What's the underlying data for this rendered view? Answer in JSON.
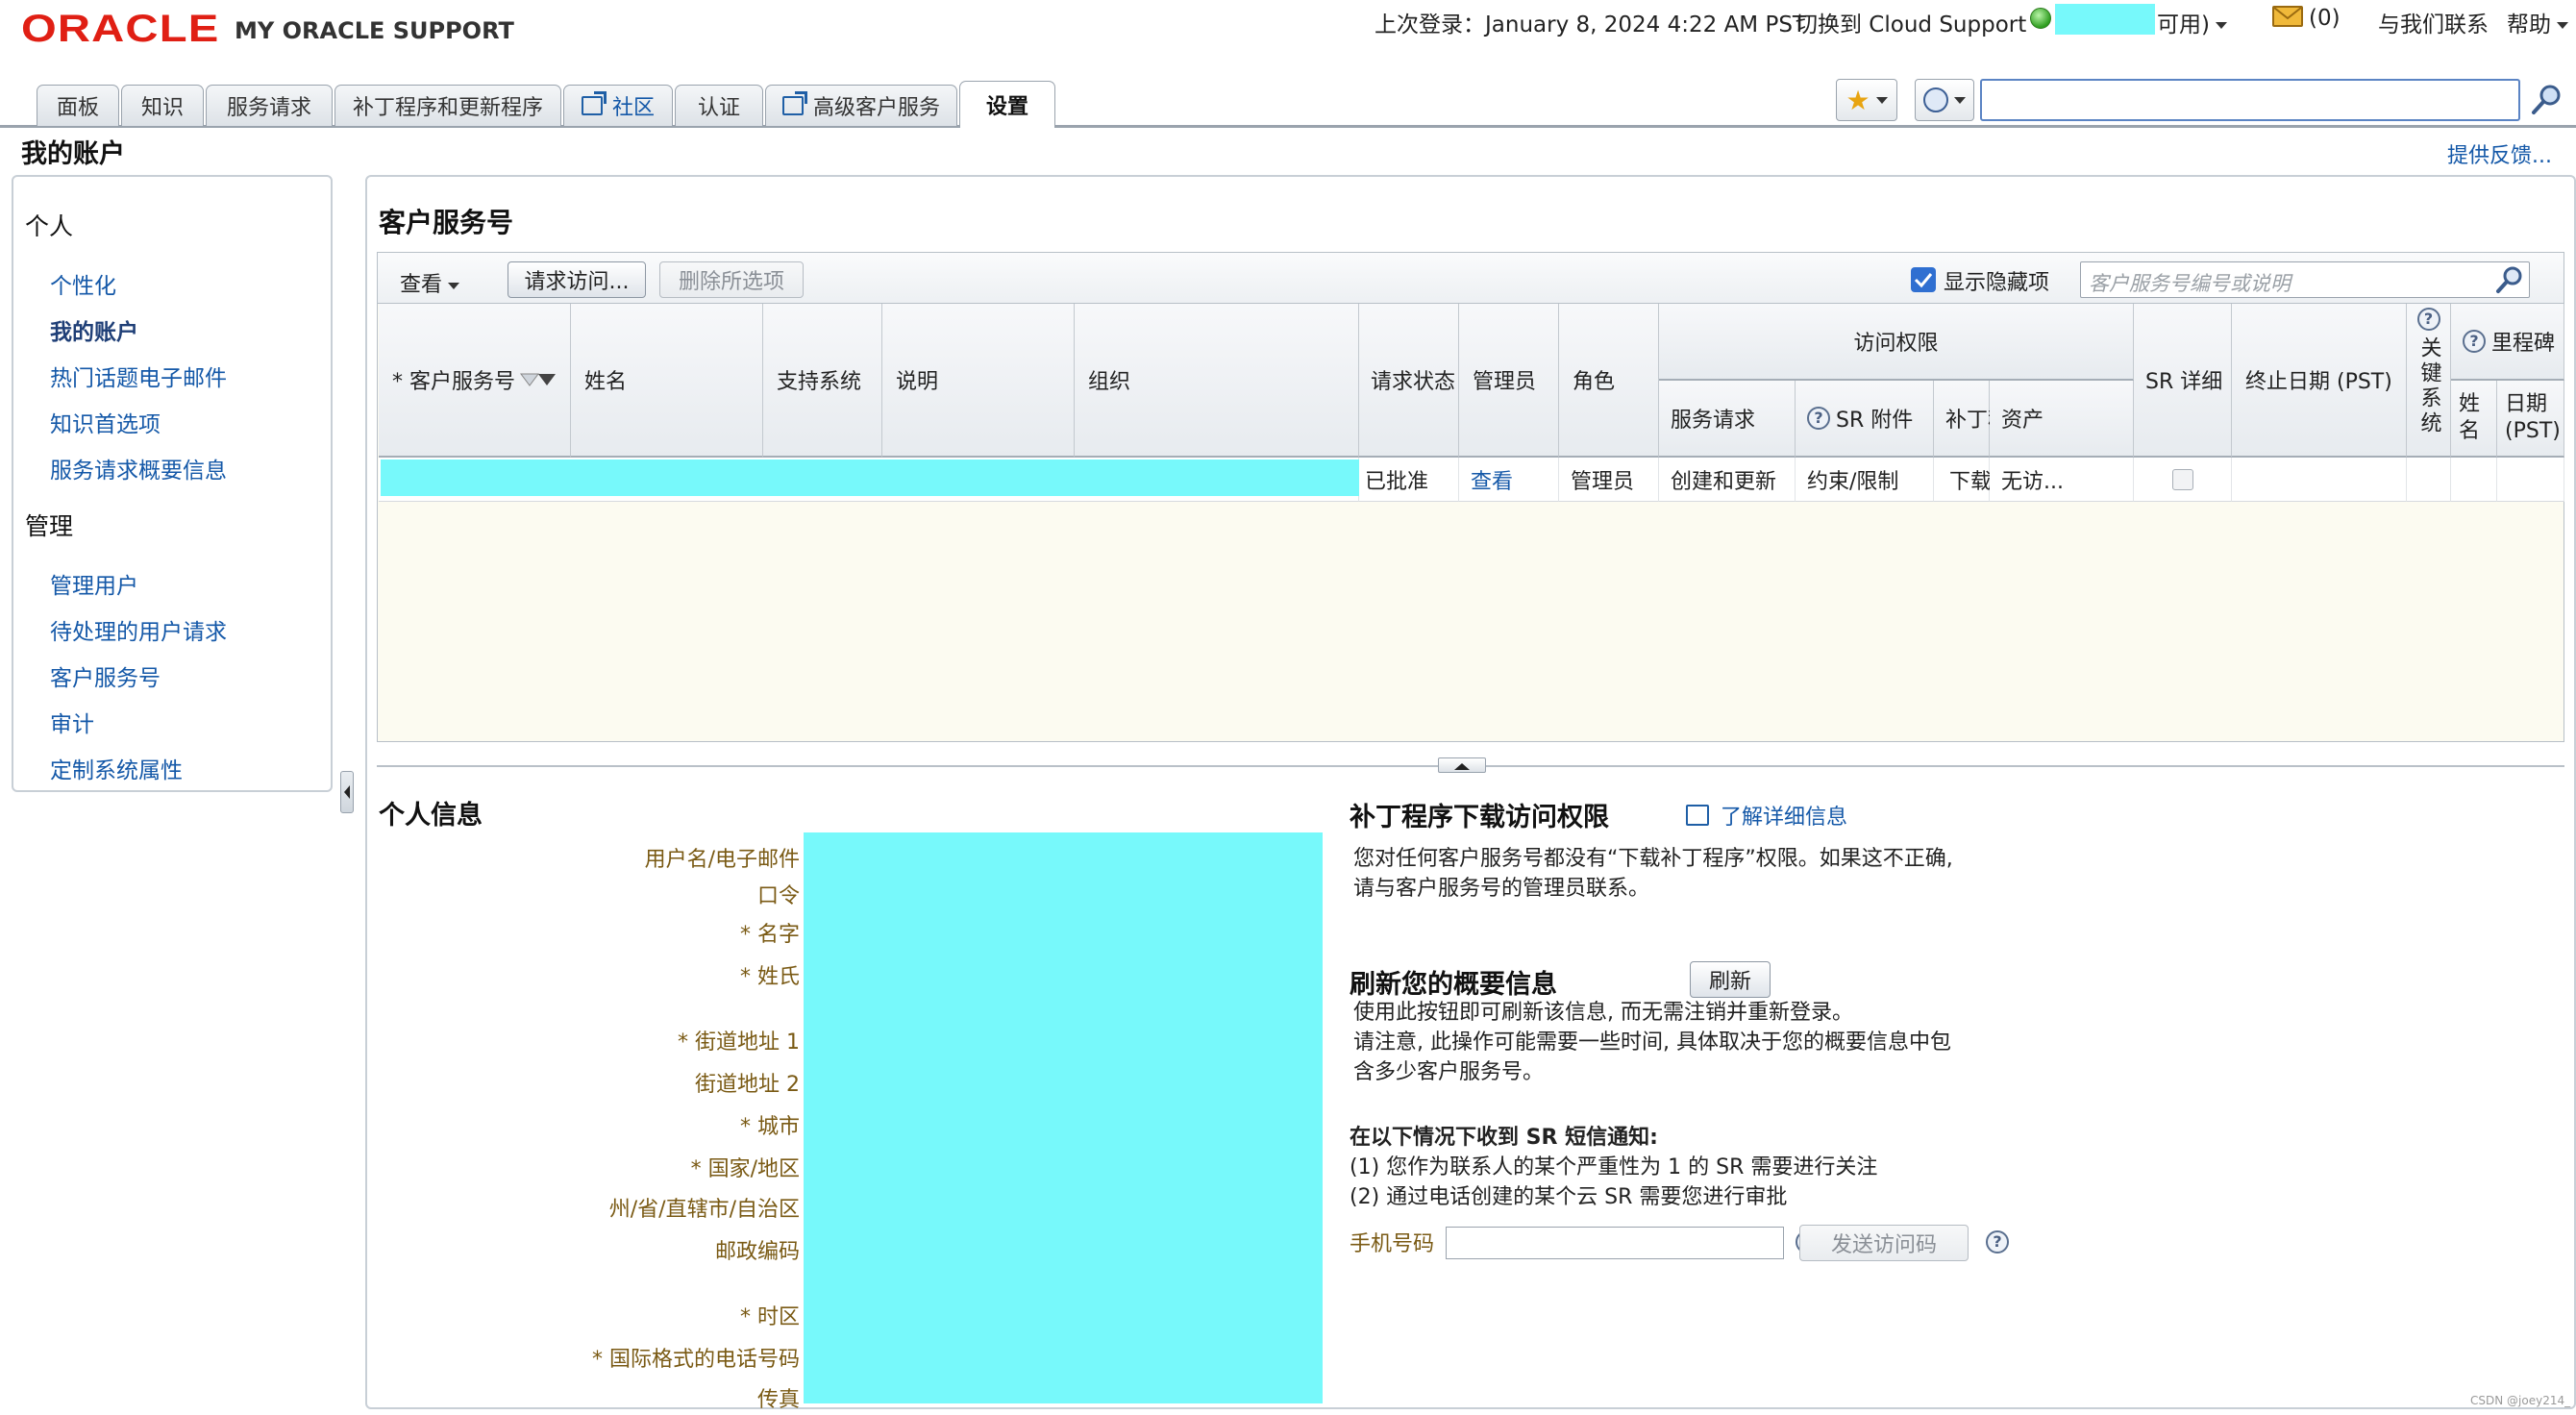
{
  "header": {
    "logo": "ORACLE",
    "product": "MY ORACLE SUPPORT",
    "last_login": "上次登录：January 8, 2024 4:22 AM PST",
    "switch_cloud": "切换到 Cloud Support",
    "availability": "可用)",
    "messages": "(0)",
    "contact": "与我们联系",
    "help": "帮助"
  },
  "tabs": [
    "面板",
    "知识",
    "服务请求",
    "补丁程序和更新程序",
    "社区",
    "认证",
    "高级客户服务",
    "设置"
  ],
  "page": {
    "title": "我的账户",
    "feedback": "提供反馈..."
  },
  "sidebar": {
    "personal_header": "个人",
    "personal_items": [
      "个性化",
      "我的账户",
      "热门话题电子邮件",
      "知识首选项",
      "服务请求概要信息"
    ],
    "admin_header": "管理",
    "admin_items": [
      "管理用户",
      "待处理的用户请求",
      "客户服务号",
      "审计",
      "定制系统属性"
    ]
  },
  "csi": {
    "title": "客户服务号",
    "toolbar": {
      "view": "查看",
      "request_access": "请求访问...",
      "delete_selected": "删除所选项",
      "show_hidden": "显示隐藏项",
      "search_placeholder": "客户服务号编号或说明"
    },
    "columns": {
      "csi": "* 客户服务号",
      "name": "姓名",
      "support_system": "支持系统",
      "description": "说明",
      "organization": "组织",
      "request_status": "请求状态",
      "admin": "管理员",
      "role": "角色",
      "access": "访问权限",
      "sr": "服务请求",
      "sr_attach": "SR 附件",
      "patch": "补丁程序",
      "asset": "资产",
      "sr_detail": "SR 详细",
      "end_date": "终止日期 (PST)",
      "key_system": "关键系统",
      "milestone": "里程碑",
      "ms_name": "姓名",
      "ms_date": "日期 (PST)"
    },
    "row": {
      "request_status": "已批准",
      "admin": "查看",
      "role": "管理员",
      "sr": "创建和更新",
      "sr_attach": "约束/限制",
      "patch": "下载",
      "asset": "无访..."
    }
  },
  "personal_info": {
    "title": "个人信息",
    "labels": [
      "用户名/电子邮件",
      "口令",
      "* 名字",
      "* 姓氏",
      "* 街道地址 1",
      "街道地址 2",
      "* 城市",
      "* 国家/地区",
      "州/省/直辖市/自治区",
      "邮政编码",
      "* 时区",
      "* 国际格式的电话号码",
      "传真"
    ]
  },
  "patch_access": {
    "title": "补丁程序下载访问权限",
    "learn_more": "了解详细信息",
    "line1": "您对任何客户服务号都没有“下载补丁程序”权限。如果这不正确,",
    "line2": "请与客户服务号的管理员联系。"
  },
  "refresh": {
    "title": "刷新您的概要信息",
    "button": "刷新",
    "line1": "使用此按钮即可刷新该信息, 而无需注销并重新登录。",
    "line2": "请注意, 此操作可能需要一些时间, 具体取决于您的概要信息中包",
    "line3": "含多少客户服务号。"
  },
  "sms": {
    "title": "在以下情况下收到 SR 短信通知:",
    "line1": "(1) 您作为联系人的某个严重性为 1 的 SR 需要进行关注",
    "line2": "(2) 通过电话创建的某个云 SR 需要您进行审批",
    "phone_label": "手机号码",
    "send_button": "发送访问码"
  },
  "watermark": "CSDN @joey214_",
  "colors": {
    "oracle_red": "#e01f14",
    "link_blue": "#1458a8",
    "redaction": "#77f9fb",
    "label_brown": "#7a5a14"
  }
}
